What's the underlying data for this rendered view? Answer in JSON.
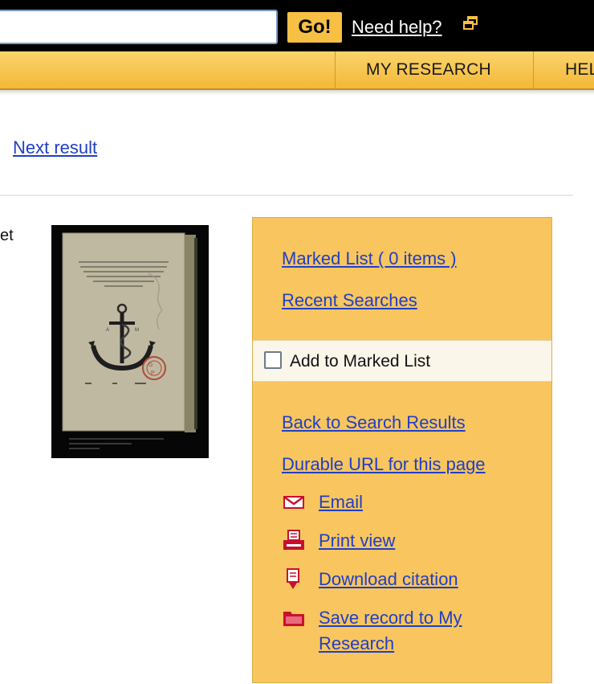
{
  "search": {
    "value": "",
    "go_label": "Go!",
    "help_label": "Need help?"
  },
  "nav": {
    "items": [
      {
        "label": "MY RESEARCH"
      },
      {
        "label": "HEL"
      }
    ]
  },
  "record_nav": {
    "next_label": "Next result"
  },
  "record": {
    "partial_title": "et"
  },
  "sidebar": {
    "marked_list_label": "Marked List  ( 0 items )",
    "recent_searches_label": "Recent Searches",
    "add_to_marked_label": "Add to Marked List",
    "back_label": "Back to Search Results",
    "durable_url_label": "Durable URL for this page",
    "email_label": "Email",
    "print_label": "Print view",
    "download_label": "Download citation",
    "save_label_1": "Save record to My",
    "save_label_2": "Research"
  },
  "colors": {
    "topbar": "#000000",
    "go_button": "#f7c044",
    "nav_bar": "#f3b837",
    "panel": "#f8c55e",
    "link": "#1f3fc5",
    "icon_red": "#c8102e"
  },
  "icons": [
    "popup-window-icon",
    "email-envelope-icon",
    "printer-icon",
    "download-citation-icon",
    "folder-icon"
  ]
}
